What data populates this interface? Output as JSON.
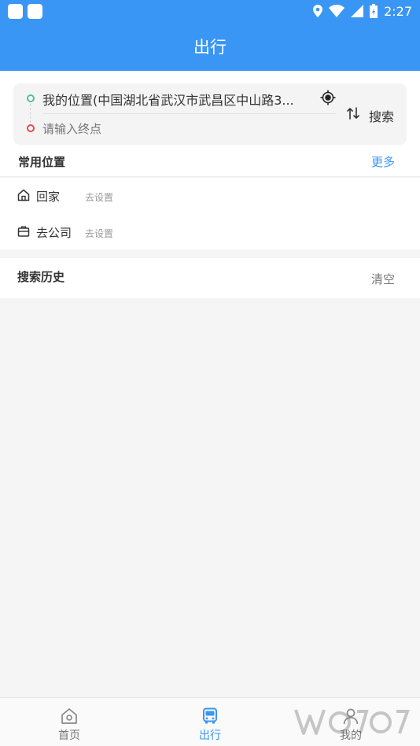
{
  "status_bar": {
    "time": "2:27"
  },
  "app_bar": {
    "title": "出行"
  },
  "route_search": {
    "start_text": "我的位置(中国湖北省武汉市武昌区中山路3...",
    "end_placeholder": "请输入终点",
    "search_label": "搜索"
  },
  "favorites": {
    "title": "常用位置",
    "more_label": "更多",
    "items": [
      {
        "label": "回家",
        "sub": "去设置",
        "icon": "home-icon"
      },
      {
        "label": "去公司",
        "sub": "去设置",
        "icon": "briefcase-icon"
      }
    ]
  },
  "history": {
    "title": "搜索历史",
    "clear_label": "清空"
  },
  "bottom_nav": {
    "items": [
      {
        "label": "首页",
        "icon": "home-icon"
      },
      {
        "label": "出行",
        "icon": "bus-icon",
        "active": true
      },
      {
        "label": "我的",
        "icon": "user-icon"
      }
    ]
  },
  "colors": {
    "primary": "#3a96f4",
    "start_dot": "#4cc48a",
    "end_dot": "#e4474d"
  }
}
